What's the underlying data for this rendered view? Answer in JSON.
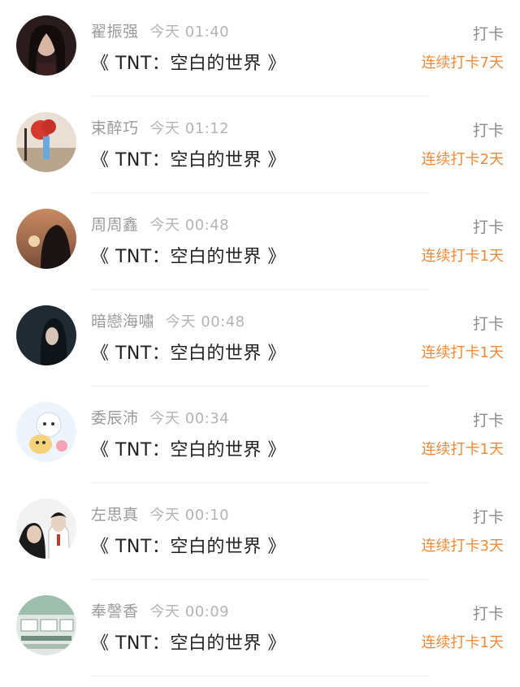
{
  "colors": {
    "accent": "#f08a3a",
    "name_gray": "#9a9a9a",
    "title_black": "#222222"
  },
  "entries": [
    {
      "name": "翟振强",
      "time": "今天 01:40",
      "title": "《 TNT：空白的世界 》",
      "action": "打卡",
      "streak": "连续打卡7天"
    },
    {
      "name": "束醉巧",
      "time": "今天 01:12",
      "title": "《 TNT：空白的世界 》",
      "action": "打卡",
      "streak": "连续打卡2天"
    },
    {
      "name": "周周鑫",
      "time": "今天 00:48",
      "title": "《 TNT：空白的世界 》",
      "action": "打卡",
      "streak": "连续打卡1天"
    },
    {
      "name": "暗戀海嘯",
      "time": "今天 00:48",
      "title": "《 TNT：空白的世界 》",
      "action": "打卡",
      "streak": "连续打卡1天"
    },
    {
      "name": "委辰沛",
      "time": "今天 00:34",
      "title": "《 TNT：空白的世界 》",
      "action": "打卡",
      "streak": "连续打卡1天"
    },
    {
      "name": "左思真",
      "time": "今天 00:10",
      "title": "《 TNT：空白的世界 》",
      "action": "打卡",
      "streak": "连续打卡3天"
    },
    {
      "name": "奉謦香",
      "time": "今天 00:09",
      "title": "《 TNT：空白的世界 》",
      "action": "打卡",
      "streak": "连续打卡1天"
    }
  ]
}
